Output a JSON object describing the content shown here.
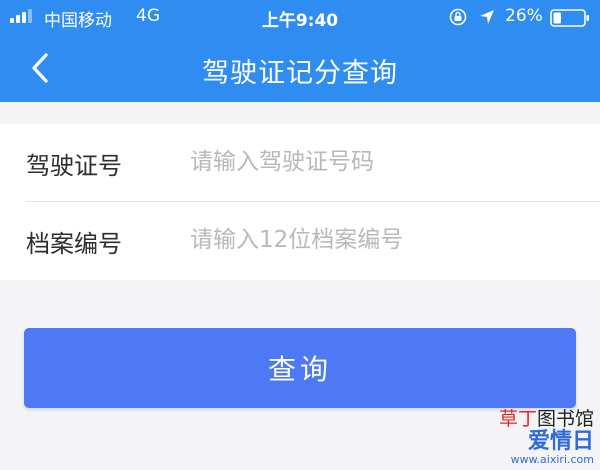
{
  "status_bar": {
    "carrier": "中国移动",
    "network": "4G",
    "time": "上午9:40",
    "battery_percent": "26%",
    "battery_level": 0.26
  },
  "header": {
    "title": "驾驶证记分查询",
    "back_icon": "chevron-left-icon",
    "color": "#2f8cf0"
  },
  "form": {
    "fields": [
      {
        "label": "驾驶证号",
        "placeholder": "请输入驾驶证号码",
        "value": ""
      },
      {
        "label": "档案编号",
        "placeholder": "请输入12位档案编号",
        "value": ""
      }
    ]
  },
  "submit": {
    "label": "查询",
    "color": "#4d79f4"
  },
  "watermark": {
    "line1_accent": "草丁",
    "line1_rest": "图书馆",
    "line2": "爱情日",
    "line3": "www.aixiri.com"
  }
}
